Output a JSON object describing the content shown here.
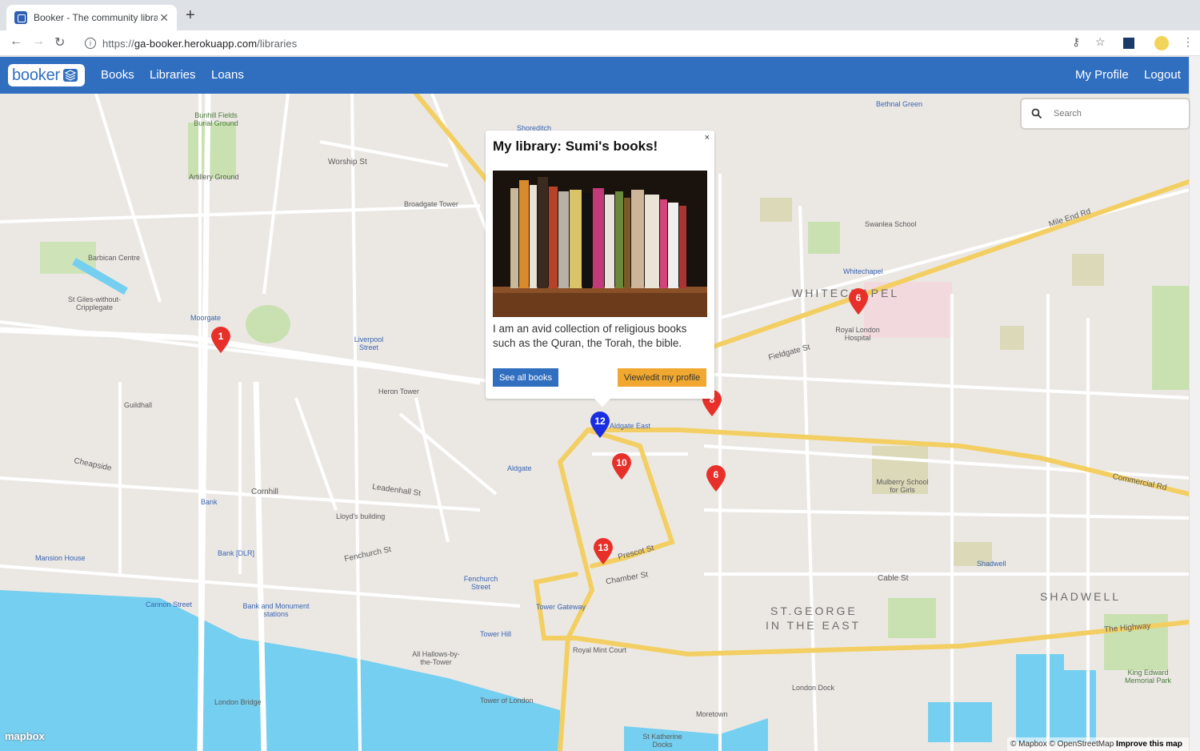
{
  "browser": {
    "tab_title": "Booker - The community librar",
    "url_scheme": "https://",
    "url_host": "ga-booker.herokuapp.com",
    "url_path": "/libraries"
  },
  "navbar": {
    "brand": "booker",
    "links": [
      "Books",
      "Libraries",
      "Loans"
    ],
    "right_links": [
      "My Profile",
      "Logout"
    ]
  },
  "search": {
    "placeholder": "Search"
  },
  "popup": {
    "title": "My library: Sumi's books!",
    "close": "×",
    "description": "I am an avid collection of religious books such as the Quran, the Torah, the bible.",
    "see_all_books": "See all books",
    "view_edit_profile": "View/edit my profile"
  },
  "markers": [
    {
      "label": "1",
      "color": "#e8302a"
    },
    {
      "label": "6",
      "color": "#e8302a"
    },
    {
      "label": "8",
      "color": "#e8302a"
    },
    {
      "label": "12",
      "color": "#1a2ee0"
    },
    {
      "label": "10",
      "color": "#e8302a"
    },
    {
      "label": "6",
      "color": "#e8302a"
    },
    {
      "label": "13",
      "color": "#e8302a"
    }
  ],
  "map_labels": {
    "whitechapel": "WHITECHAPEL",
    "st_george": "ST.GEORGE",
    "in_the_east": "IN THE EAST",
    "shadwell": "SHADWELL",
    "moorgate": "Moorgate",
    "liverpool_street": "Liverpool Street",
    "bank": "Bank",
    "aldgate": "Aldgate",
    "aldgate_east": "Aldgate East",
    "tower_gateway": "Tower Gateway",
    "tower_hill": "Tower Hill",
    "fenchurch_street": "Fenchurch Street",
    "cannon_street": "Cannon Street",
    "mansion_house": "Mansion House",
    "shadwell_stn": "Shadwell",
    "whitechapel_stn": "Whitechapel",
    "bethnal_green": "Bethnal Green",
    "shoreditch": "Shoreditch",
    "london_bridge": "London Bridge",
    "royal_london": "Royal London Hospital",
    "tower_of_london": "Tower of London",
    "royal_mint_court": "Royal Mint Court",
    "london_dock": "London Dock",
    "worship_st": "Worship St",
    "cornhill": "Cornhill",
    "cheapside": "Cheapside",
    "fenchurch_st": "Fenchurch St",
    "leadenhall_st": "Leadenhall St",
    "commercial_rd": "Commercial Rd",
    "the_highway": "The Highway",
    "mile_end_rd": "Mile End Rd",
    "fieldgate_st": "Fieldgate St",
    "cable_st": "Cable St",
    "prescot_st": "Prescot St",
    "chamber_st": "Chamber St",
    "barbican": "Barbican Centre",
    "artillery": "Artillery Ground",
    "guildhall": "Guildhall",
    "heron_tower": "Heron Tower",
    "broadgate": "Broadgate Tower",
    "lloyds": "Lloyd's building",
    "all_hallows": "All Hallows-by-the-Tower",
    "moretown": "Moretown",
    "st_katherine": "St Katherine Docks",
    "king_edward": "King Edward Memorial Park",
    "mulberry": "Mulberry School for Girls",
    "swanlea": "Swanlea School",
    "bank_dlr": "Bank [DLR]",
    "bank_monument": "Bank and Monument stations",
    "st_giles": "St Giles-without-Cripplegate",
    "bunhill": "Bunhill Fields Burial Ground"
  },
  "attribution": {
    "mapbox": "© Mapbox",
    "osm": "© OpenStreetMap",
    "improve": "Improve this map",
    "logo": "mapbox"
  }
}
